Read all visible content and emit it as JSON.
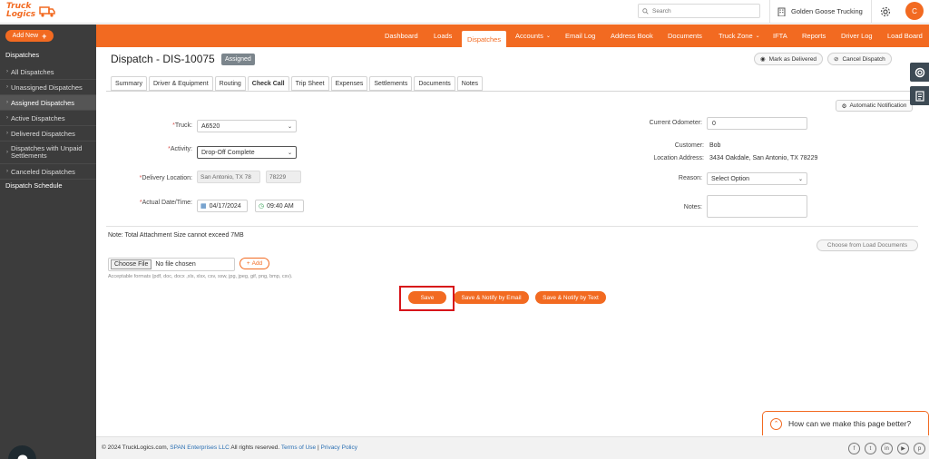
{
  "brand": {
    "logo_line1": "Truck",
    "logo_line2": "Logics",
    "accent": "#f26a21"
  },
  "header": {
    "search_placeholder": "Search",
    "company": "Golden Goose Trucking",
    "avatar_initial": "C"
  },
  "sidebar": {
    "add_new": "Add New",
    "section": "Dispatches",
    "items": [
      {
        "label": "All Dispatches"
      },
      {
        "label": "Unassigned Dispatches"
      },
      {
        "label": "Assigned Dispatches"
      },
      {
        "label": "Active Dispatches"
      },
      {
        "label": "Delivered Dispatches"
      },
      {
        "label": "Dispatches with Unpaid Settlements"
      },
      {
        "label": "Canceled Dispatches"
      }
    ],
    "schedule": "Dispatch Schedule"
  },
  "nav": {
    "items": [
      {
        "label": "Dashboard"
      },
      {
        "label": "Loads"
      },
      {
        "label": "Dispatches"
      },
      {
        "label": "Accounts"
      },
      {
        "label": "Email Log"
      },
      {
        "label": "Address Book"
      },
      {
        "label": "Documents"
      },
      {
        "label": "Truck Zone"
      },
      {
        "label": "IFTA"
      },
      {
        "label": "Reports"
      },
      {
        "label": "Driver Log"
      },
      {
        "label": "Load Board"
      }
    ]
  },
  "page": {
    "title": "Dispatch - DIS-10075",
    "status": "Assigned",
    "mark_delivered": "Mark as Delivered",
    "cancel_dispatch": "Cancel Dispatch"
  },
  "tabs": [
    "Summary",
    "Driver & Equipment",
    "Routing",
    "Check Call",
    "Trip Sheet",
    "Expenses",
    "Settlements",
    "Documents",
    "Notes"
  ],
  "form": {
    "auto_notification": "Automatic Notification",
    "truck_label": "Truck:",
    "truck_value": "A6520",
    "activity_label": "Activity:",
    "activity_value": "Drop-Off Complete",
    "delivery_location_label": "Delivery Location:",
    "delivery_city": "San Antonio, TX 78",
    "delivery_zip": "78229",
    "actual_datetime_label": "Actual Date/Time:",
    "date": "04/17/2024",
    "time": "09:40 AM",
    "odometer_label": "Current Odometer:",
    "odometer_value": "0",
    "customer_label": "Customer:",
    "customer_value": "Bob",
    "location_address_label": "Location Address:",
    "location_address_value": "3434 Oakdale, San Antonio, TX 78229",
    "reason_label": "Reason:",
    "reason_value": "Select Option",
    "notes_label": "Notes:",
    "req_mark": "*"
  },
  "attachments": {
    "note": "Note: Total Attachment Size cannot exceed 7MB",
    "from_load": "Choose from Load Documents",
    "choose_file": "Choose File",
    "no_file": "No file chosen",
    "add": "Add",
    "formats": "Acceptable formats (pdf, doc, docx ,xls, xlsx, csv, ssw, jpg, jpeg, gif, png, bmp, csv)."
  },
  "actions": {
    "save": "Save",
    "save_email": "Save & Notify by Email",
    "save_text": "Save & Notify by Text"
  },
  "feedback": {
    "text": "How can we make this page better?"
  },
  "footer": {
    "copyright": "© 2024 TruckLogics.com,",
    "span": "SPAN Enterprises LLC",
    "rights": "All rights reserved.",
    "terms": "Terms of Use",
    "sep": "|",
    "privacy": "Privacy Policy"
  }
}
